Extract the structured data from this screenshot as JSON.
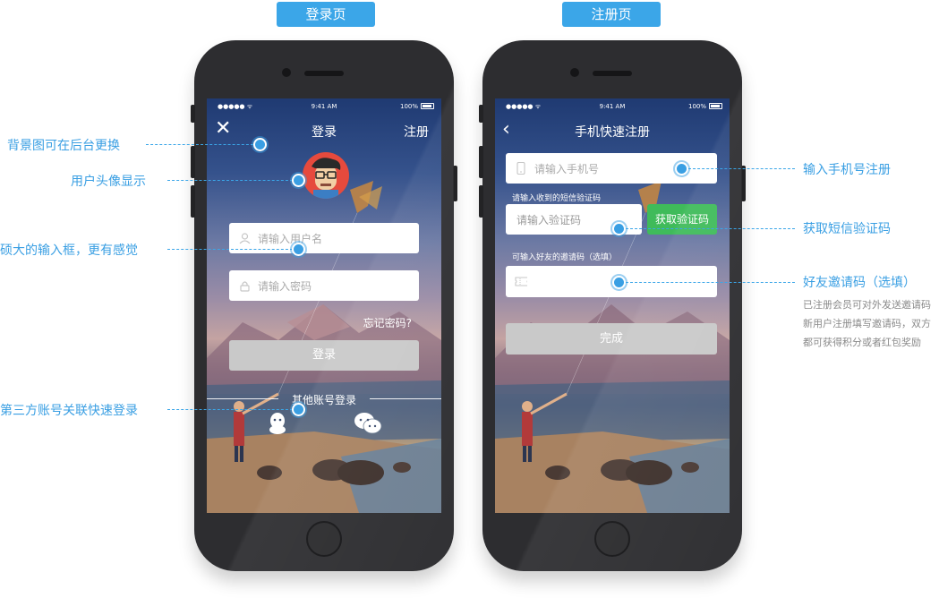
{
  "tags": {
    "login": "登录页",
    "register": "注册页"
  },
  "status": {
    "signal": "●●●●● ᯤ",
    "time": "9:41 AM",
    "battery": "100%"
  },
  "login": {
    "title": "登录",
    "close_icon": "close-icon",
    "register_link": "注册",
    "username_placeholder": "请输入用户名",
    "password_placeholder": "请输入密码",
    "forgot": "忘记密码?",
    "button": "登录",
    "other_login": "其他账号登录"
  },
  "register": {
    "title": "手机快速注册",
    "phone_placeholder": "请输入手机号",
    "code_label": "请输入收到的短信验证码",
    "code_placeholder": "请输入验证码",
    "get_code_button": "获取验证码",
    "invite_label": "可输入好友的邀请码（选填）",
    "done_button": "完成"
  },
  "annotations": {
    "bg": "背景图可在后台更换",
    "avatar": "用户头像显示",
    "input": "硕大的输入框，更有感觉",
    "third_party": "第三方账号关联快速登录",
    "phone": "输入手机号注册",
    "sms": "获取短信验证码",
    "invite": "好友邀请码（选填）",
    "invite_note": [
      "已注册会员可对外发送邀请码",
      "新用户注册填写邀请码，双方",
      "都可获得积分或者红包奖励"
    ]
  },
  "colors": {
    "accent": "#3ba6e8",
    "green": "#3fbb5a",
    "phone_body": "#2d2d30"
  }
}
